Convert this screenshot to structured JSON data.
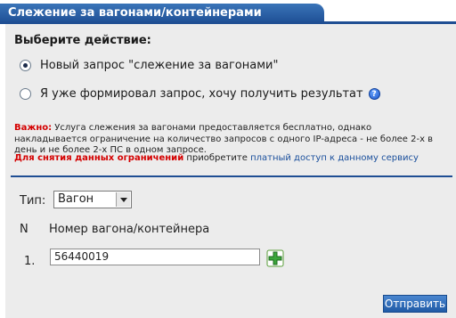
{
  "header": {
    "title": "Слежение за вагонами/контейнерами"
  },
  "form": {
    "choose_label": "Выберите действие:",
    "options": [
      {
        "label": "Новый запрос \"слежение за вагонами\"",
        "selected": true
      },
      {
        "label": "Я уже формировал запрос, хочу получить результат",
        "selected": false
      }
    ],
    "notice": {
      "warning_label": "Важно:",
      "warning_text": "Услуга слежения за вагонами предоставляется бесплатно, однако накладывается ограничение на количество запросов с одного IP-адреса - не более 2-х в день и не более 2-х ПС в одном запросе.",
      "limit_label": "Для снятия данных ограничений",
      "limit_text": "приобретите",
      "limit_link": "платный доступ к данному сервису"
    },
    "type_label": "Тип:",
    "type_value": "Вагон",
    "columns": {
      "n": "N",
      "number": "Номер вагона/контейнера"
    },
    "rows": [
      {
        "index": "1.",
        "value": "56440019"
      }
    ],
    "submit_label": "Отправить"
  },
  "colors": {
    "header_bg": "#1f4e93",
    "panel_bg": "#ececec",
    "warning": "#d40000",
    "link": "#1a4f9c"
  }
}
